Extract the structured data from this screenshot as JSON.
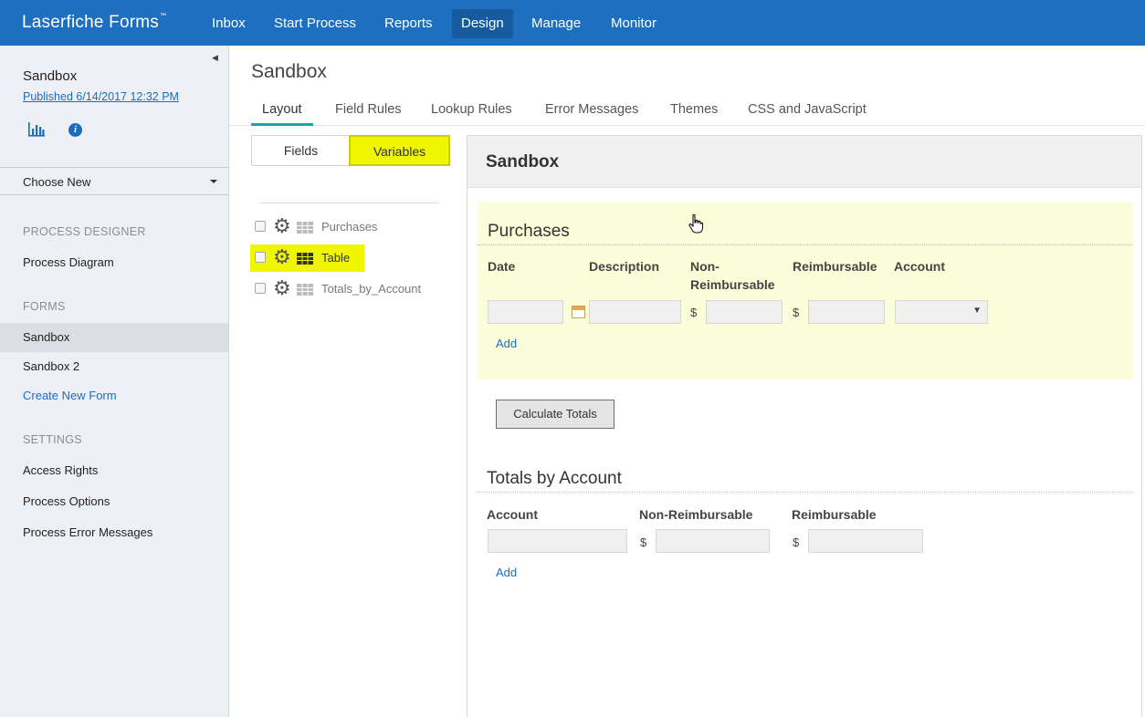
{
  "topnav": {
    "brand": "Laserfiche Forms",
    "brand_mark": "™",
    "items": [
      {
        "label": "Inbox"
      },
      {
        "label": "Start Process"
      },
      {
        "label": "Reports"
      },
      {
        "label": "Design",
        "active": true
      },
      {
        "label": "Manage"
      },
      {
        "label": "Monitor"
      }
    ]
  },
  "sidebar": {
    "process_name": "Sandbox",
    "published": "Published 6/14/2017 12:32 PM",
    "choose_new": "Choose New",
    "sections": {
      "process_designer": {
        "heading": "PROCESS DESIGNER",
        "items": [
          {
            "label": "Process Diagram"
          }
        ]
      },
      "forms": {
        "heading": "FORMS",
        "items": [
          {
            "label": "Sandbox",
            "selected": true
          },
          {
            "label": "Sandbox 2"
          },
          {
            "label": "Create New Form"
          }
        ]
      },
      "settings": {
        "heading": "SETTINGS",
        "items": [
          {
            "label": "Access Rights"
          },
          {
            "label": "Process Options"
          },
          {
            "label": "Process Error Messages"
          }
        ]
      }
    }
  },
  "main": {
    "title": "Sandbox",
    "tabs": [
      {
        "label": "Layout",
        "active": true
      },
      {
        "label": "Field Rules"
      },
      {
        "label": "Lookup Rules"
      },
      {
        "label": "Error Messages"
      },
      {
        "label": "Themes"
      },
      {
        "label": "CSS and JavaScript"
      }
    ],
    "toggle": {
      "fields": "Fields",
      "variables": "Variables",
      "selected": "variables"
    },
    "variables": [
      {
        "label": "Purchases",
        "highlighted": false
      },
      {
        "label": "Table",
        "highlighted": true
      },
      {
        "label": "Totals_by_Account",
        "highlighted": false
      }
    ]
  },
  "preview": {
    "form_title": "Sandbox",
    "purchases": {
      "title": "Purchases",
      "columns": [
        "Date",
        "Description",
        "Non-Reimbursable",
        "Reimbursable",
        "Account"
      ],
      "columns_display": [
        "Date",
        "Description",
        "Non-\nReimbursable",
        "Reimbursable",
        "Account"
      ],
      "currency_symbol": "$",
      "add_label": "Add"
    },
    "calculate_button": "Calculate Totals",
    "totals": {
      "title": "Totals by Account",
      "columns": [
        "Account",
        "Non-Reimbursable",
        "Reimbursable"
      ],
      "currency_symbol": "$",
      "add_label": "Add"
    }
  },
  "colors": {
    "nav_bg": "#1f6fc1",
    "highlight": "#f0f500",
    "link": "#1a6dbf",
    "section_bg": "#fcfdd9",
    "tab_accent": "#1aa5a5"
  },
  "icons": {
    "sidebar": [
      "bar-chart-icon",
      "info-icon"
    ],
    "variables": [
      "gear-icon",
      "table-icon"
    ],
    "date_picker": "calendar-icon",
    "dropdown": "chevron-down-icon",
    "pointer": "hand-cursor-icon"
  }
}
